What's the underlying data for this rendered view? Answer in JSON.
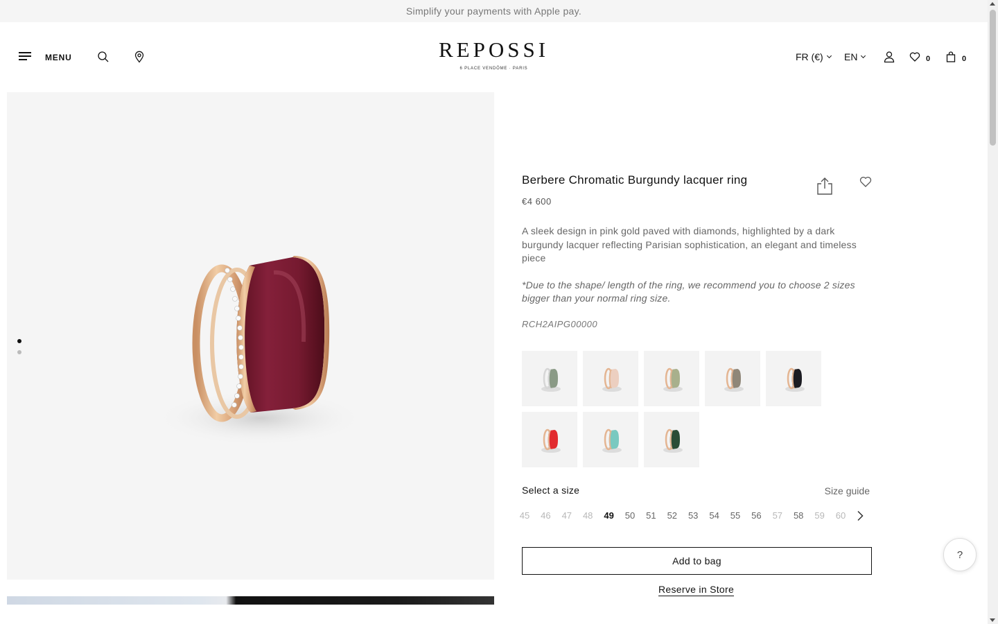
{
  "promo": {
    "text": "Simplify your payments with Apple pay."
  },
  "header": {
    "menu_label": "MENU",
    "logo": "REPOSSI",
    "logo_sub": "6 PLACE VENDÔME · PARIS",
    "currency": "FR (€)",
    "language": "EN",
    "wishlist_count": "0",
    "bag_count": "0"
  },
  "gallery": {
    "image_count": 2,
    "active_index": 0
  },
  "product": {
    "title": "Berbere Chromatic Burgundy lacquer ring",
    "price": "€4 600",
    "description": "A sleek design in pink gold paved with diamonds, highlighted by a dark burgundy lacquer reflecting Parisian sophistication, an elegant and timeless piece",
    "note": "*Due to the shape/ length of the ring, we recommend you to choose 2 sizes bigger than your normal ring size.",
    "sku": "RCH2AIPG00000",
    "colors": {
      "gold": "#e2b48c",
      "lacquer": "#7a1c2e"
    }
  },
  "variants": [
    {
      "name": "sage-silver",
      "color": "#8a9a86",
      "metal": "#d6d6d6"
    },
    {
      "name": "pale-pink",
      "color": "#eccfc0",
      "metal": "#e4b592"
    },
    {
      "name": "olive",
      "color": "#a8b08c",
      "metal": "#e4b592"
    },
    {
      "name": "taupe",
      "color": "#8f8678",
      "metal": "#e4b592"
    },
    {
      "name": "black",
      "color": "#1c1c22",
      "metal": "#e4b592"
    },
    {
      "name": "red",
      "color": "#e22a2e",
      "metal": "#e4b592"
    },
    {
      "name": "turquoise",
      "color": "#79c9c0",
      "metal": "#e4b592"
    },
    {
      "name": "forest-green",
      "color": "#2b4d36",
      "metal": "#e4b592"
    }
  ],
  "size": {
    "label": "Select a size",
    "guide_label": "Size guide",
    "options": [
      {
        "value": "45",
        "state": "unavail"
      },
      {
        "value": "46",
        "state": "unavail"
      },
      {
        "value": "47",
        "state": "unavail"
      },
      {
        "value": "48",
        "state": "unavail"
      },
      {
        "value": "49",
        "state": "sel"
      },
      {
        "value": "50",
        "state": "avail"
      },
      {
        "value": "51",
        "state": "avail"
      },
      {
        "value": "52",
        "state": "avail"
      },
      {
        "value": "53",
        "state": "avail"
      },
      {
        "value": "54",
        "state": "avail"
      },
      {
        "value": "55",
        "state": "avail"
      },
      {
        "value": "56",
        "state": "avail"
      },
      {
        "value": "57",
        "state": "unavail"
      },
      {
        "value": "58",
        "state": "avail"
      },
      {
        "value": "59",
        "state": "unavail"
      },
      {
        "value": "60",
        "state": "unavail"
      }
    ]
  },
  "actions": {
    "add_to_bag": "Add to bag",
    "reserve": "Reserve in Store",
    "help": "?"
  }
}
